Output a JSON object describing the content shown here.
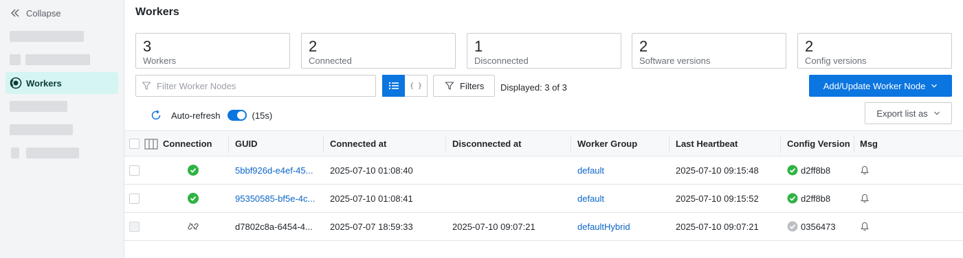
{
  "sidebar": {
    "collapse_label": "Collapse",
    "active_item_label": "Workers"
  },
  "page": {
    "title": "Workers"
  },
  "stats": [
    {
      "value": "3",
      "label": "Workers"
    },
    {
      "value": "2",
      "label": "Connected"
    },
    {
      "value": "1",
      "label": "Disconnected"
    },
    {
      "value": "2",
      "label": "Software versions"
    },
    {
      "value": "2",
      "label": "Config versions"
    }
  ],
  "toolbar": {
    "filter_placeholder": "Filter Worker Nodes",
    "filters_label": "Filters",
    "displayed": "Displayed: 3 of 3",
    "add_update_label": "Add/Update Worker Node",
    "export_label": "Export list as",
    "autorefresh_label": "Auto-refresh",
    "autorefresh_interval": "(15s)"
  },
  "table": {
    "columns": [
      "Connection",
      "GUID",
      "Connected at",
      "Disconnected at",
      "Worker Group",
      "Last Heartbeat",
      "Config Version",
      "Msg"
    ],
    "rows": [
      {
        "connection": "connected-icon",
        "guid": "5bbf926d-e4ef-45...",
        "connected_at": "2025-07-10 01:08:40",
        "disconnected_at": "",
        "group": "default",
        "heartbeat": "2025-07-10 09:15:48",
        "config_status": "ok",
        "config": "d2ff8b8"
      },
      {
        "connection": "connected-icon",
        "guid": "95350585-bf5e-4c...",
        "connected_at": "2025-07-10 01:08:41",
        "disconnected_at": "",
        "group": "default",
        "heartbeat": "2025-07-10 09:15:52",
        "config_status": "ok",
        "config": "d2ff8b8"
      },
      {
        "connection": "disconnected-link-icon",
        "guid": "d7802c8a-6454-4...",
        "connected_at": "2025-07-07 18:59:33",
        "disconnected_at": "2025-07-10 09:07:21",
        "group": "defaultHybrid",
        "heartbeat": "2025-07-10 09:07:21",
        "config_status": "unknown",
        "config": "0356473"
      }
    ]
  },
  "colors": {
    "accent": "#0b75e0",
    "success": "#2fb344",
    "muted": "#bcc0c5",
    "active_nav_bg": "#d4f5f2"
  }
}
